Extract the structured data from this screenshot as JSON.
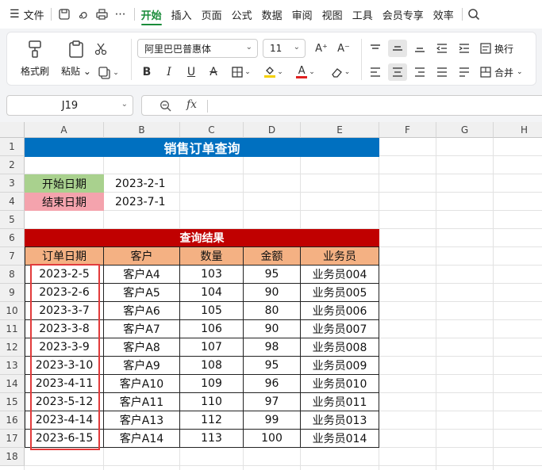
{
  "menubar": {
    "file_label": "文件",
    "tabs": [
      "开始",
      "插入",
      "页面",
      "公式",
      "数据",
      "审阅",
      "视图",
      "工具",
      "会员专享",
      "效率"
    ],
    "active_tab": "开始",
    "more_label": "⋯"
  },
  "ribbon": {
    "format_painter": "格式刷",
    "paste": "粘贴",
    "font_name": "阿里巴巴普惠体",
    "font_size": "11",
    "wrap": "换行",
    "merge": "合并",
    "bold": "B",
    "italic": "I",
    "underline": "U",
    "strike": "A",
    "grow": "A⁺",
    "shrink": "A⁻",
    "font_color": "#e02020",
    "fill_color": "#f5d000"
  },
  "formula_bar": {
    "cell_ref": "J19",
    "fx_label": "fx",
    "value": ""
  },
  "columns": [
    "A",
    "B",
    "C",
    "D",
    "E",
    "F",
    "G",
    "H"
  ],
  "rows": [
    "1",
    "2",
    "3",
    "4",
    "5",
    "6",
    "7",
    "8",
    "9",
    "10",
    "11",
    "12",
    "13",
    "14",
    "15",
    "16",
    "17",
    "18"
  ],
  "sheet": {
    "title": "销售订单查询",
    "title_bg": "#0070c0",
    "start_label": "开始日期",
    "start_value": "2023-2-1",
    "start_bg": "#a9d18e",
    "end_label": "结束日期",
    "end_value": "2023-7-1",
    "end_bg": "#f4a3ad",
    "result_label": "查询结果",
    "result_bg": "#c00000",
    "header_bg": "#f4b183",
    "headers": [
      "订单日期",
      "客户",
      "数量",
      "金额",
      "业务员"
    ],
    "records": [
      [
        "2023-2-5",
        "客户A4",
        "103",
        "95",
        "业务员004"
      ],
      [
        "2023-2-6",
        "客户A5",
        "104",
        "90",
        "业务员005"
      ],
      [
        "2023-3-7",
        "客户A6",
        "105",
        "80",
        "业务员006"
      ],
      [
        "2023-3-8",
        "客户A7",
        "106",
        "90",
        "业务员007"
      ],
      [
        "2023-3-9",
        "客户A8",
        "107",
        "98",
        "业务员008"
      ],
      [
        "2023-3-10",
        "客户A9",
        "108",
        "95",
        "业务员009"
      ],
      [
        "2023-4-11",
        "客户A10",
        "109",
        "96",
        "业务员010"
      ],
      [
        "2023-5-12",
        "客户A11",
        "110",
        "97",
        "业务员011"
      ],
      [
        "2023-4-14",
        "客户A13",
        "112",
        "99",
        "业务员013"
      ],
      [
        "2023-6-15",
        "客户A14",
        "113",
        "100",
        "业务员014"
      ]
    ],
    "highlight_color": "#e23b3b"
  }
}
